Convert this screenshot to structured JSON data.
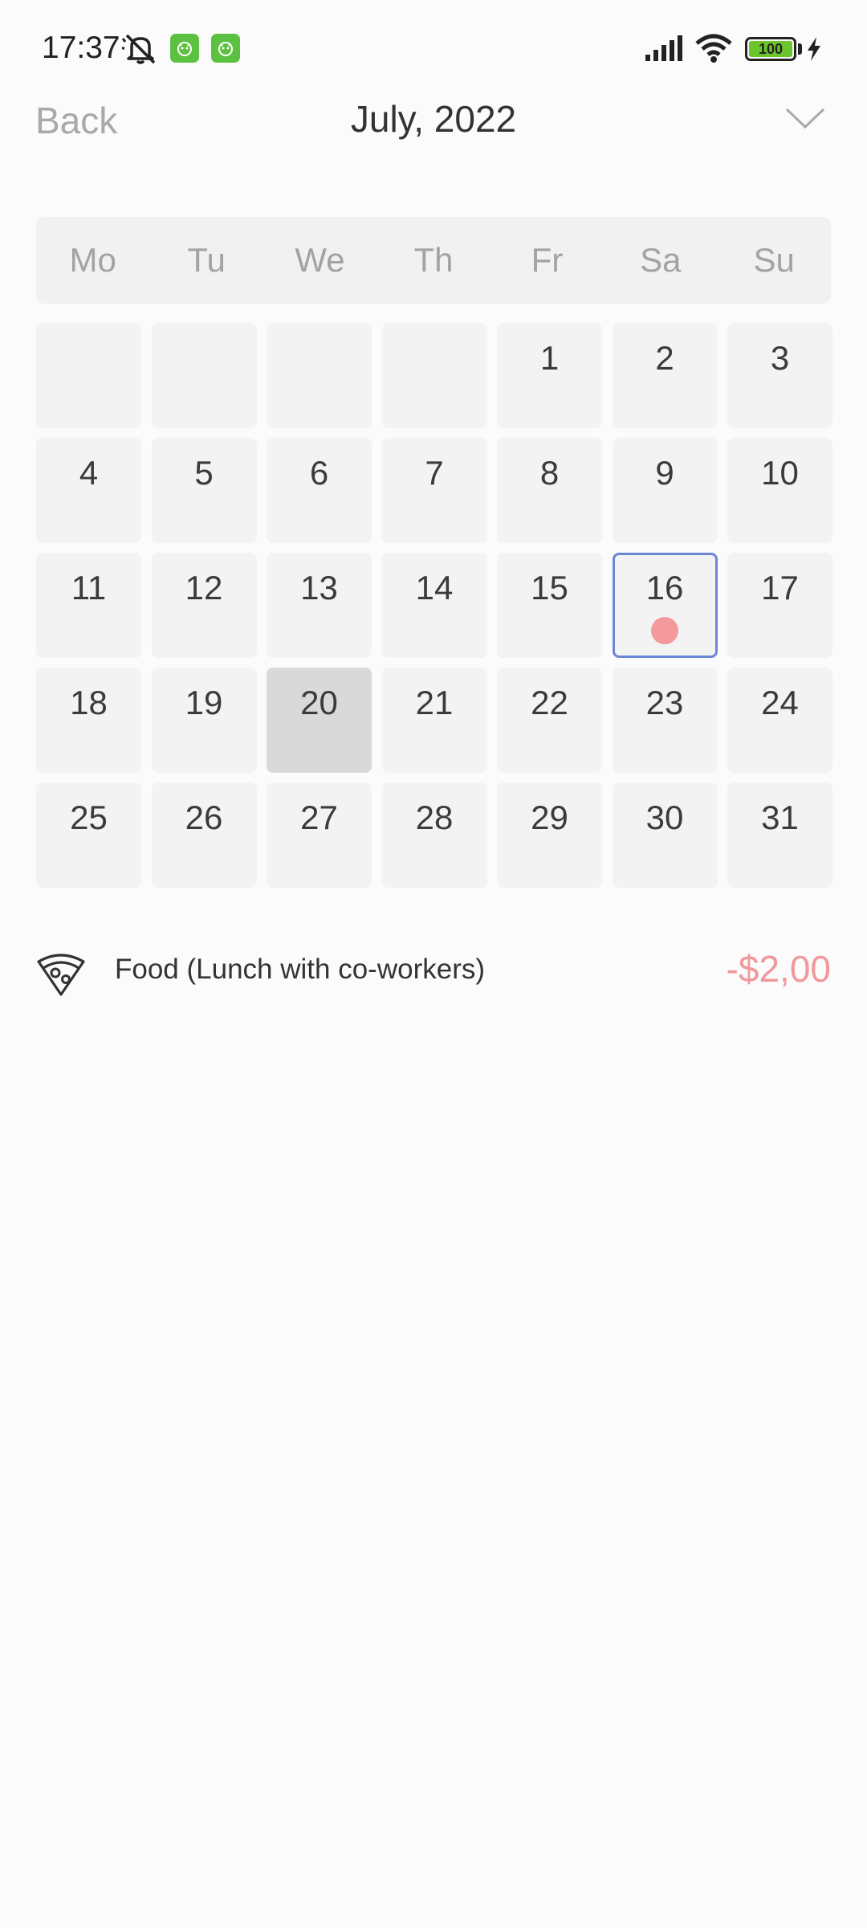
{
  "status_bar": {
    "time": "17:37",
    "battery_level": "100",
    "icons": [
      "mute-icon",
      "app-badge-icon",
      "app-badge-icon",
      "signal-icon",
      "wifi-icon",
      "battery-icon",
      "charging-bolt-icon"
    ]
  },
  "header": {
    "back_label": "Back",
    "title": "July, 2022",
    "dropdown_icon": "chevron-down-icon"
  },
  "calendar": {
    "weekdays": [
      "Mo",
      "Tu",
      "We",
      "Th",
      "Fr",
      "Sa",
      "Su"
    ],
    "leading_blank_days": 4,
    "days_in_month": 31,
    "today": 20,
    "selected_day": 16,
    "event_days": [
      16
    ]
  },
  "transactions": [
    {
      "icon": "pizza-icon",
      "label": "Food (Lunch with co-workers)",
      "amount": "-$2,00"
    }
  ],
  "colors": {
    "background": "#fbfbfb",
    "cell": "#f3f3f3",
    "today_cell": "#d9d9d9",
    "selected_border": "#6c86d6",
    "event_dot": "#f4999c",
    "expense_amount": "#f0989b"
  }
}
